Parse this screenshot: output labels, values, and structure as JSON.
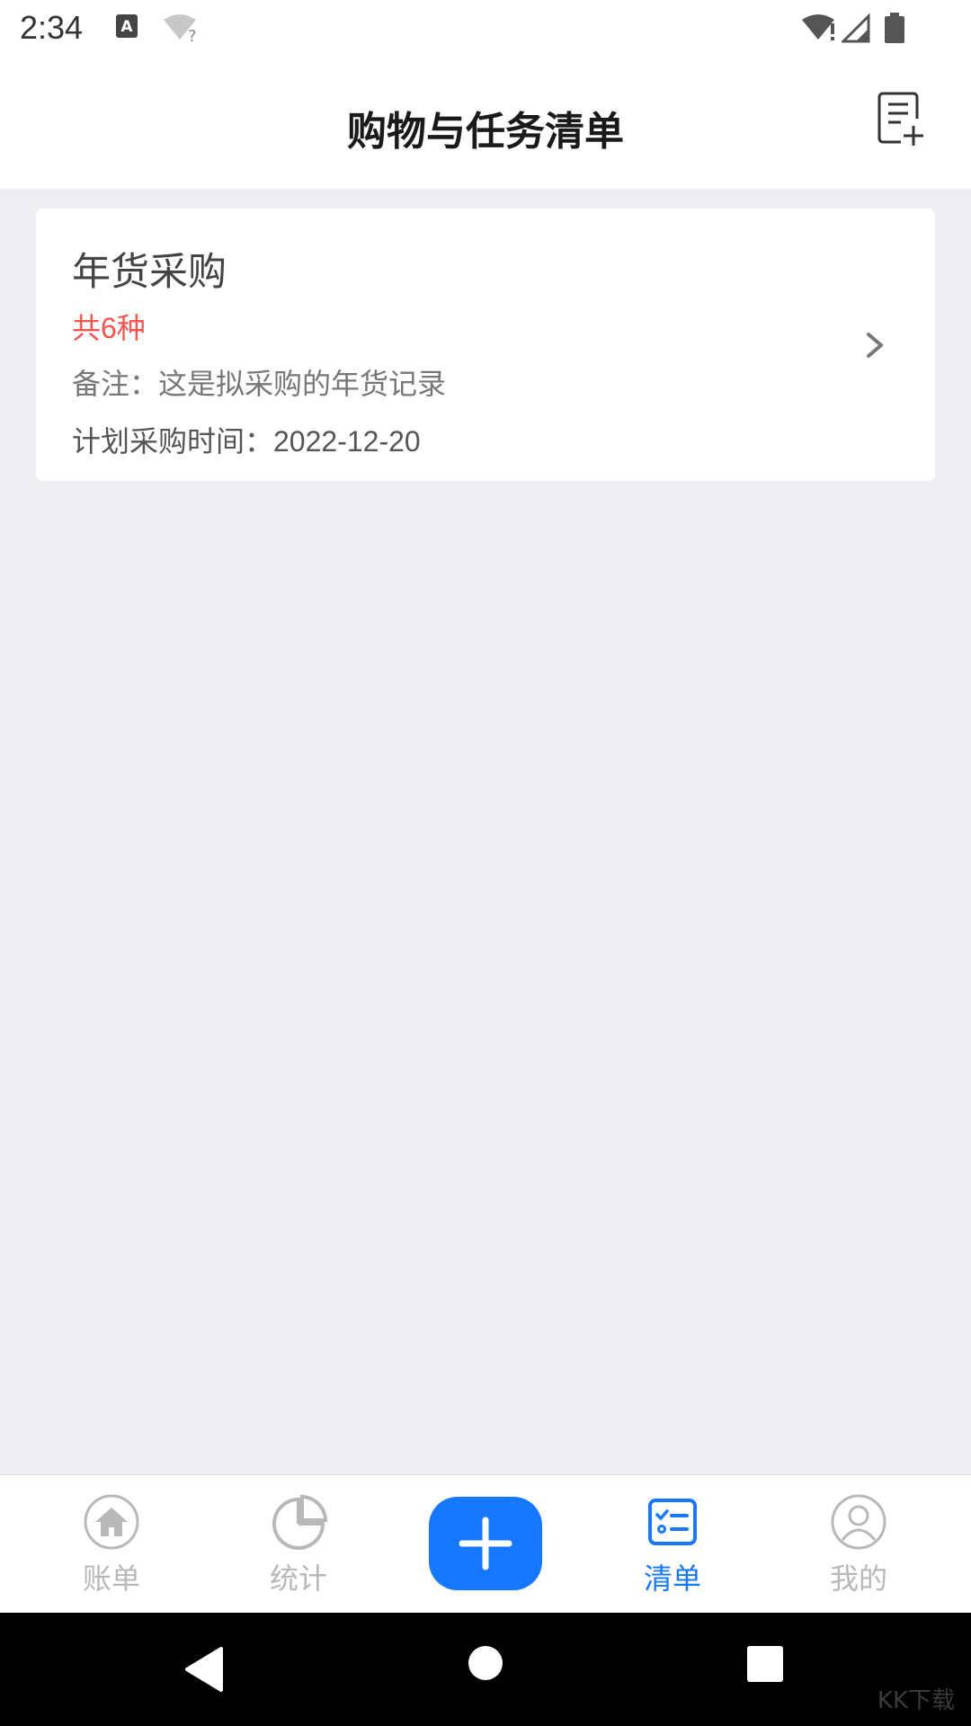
{
  "status_bar": {
    "time": "2:34",
    "icons": [
      "keyboard-a-icon",
      "wifi-unknown-icon",
      "wifi-alert-icon",
      "signal-icon",
      "battery-icon"
    ]
  },
  "header": {
    "title": "购物与任务清单",
    "add_button_icon": "add-list-icon"
  },
  "lists": [
    {
      "title": "年货采购",
      "count": "共6种",
      "note": "备注：这是拟采购的年货记录",
      "planned_date": "计划采购时间：2022-12-20"
    }
  ],
  "tabs": [
    {
      "label": "账单",
      "icon": "home-icon",
      "active": false
    },
    {
      "label": "统计",
      "icon": "pie-chart-icon",
      "active": false
    },
    {
      "label": "",
      "icon": "plus-icon",
      "active": false
    },
    {
      "label": "清单",
      "icon": "checklist-icon",
      "active": true
    },
    {
      "label": "我的",
      "icon": "profile-icon",
      "active": false
    }
  ],
  "colors": {
    "accent": "#1677ff",
    "count_red": "#f5544f",
    "background": "#eeeef3",
    "inactive_tab": "#b8b8b8"
  },
  "watermark": "KK下载"
}
